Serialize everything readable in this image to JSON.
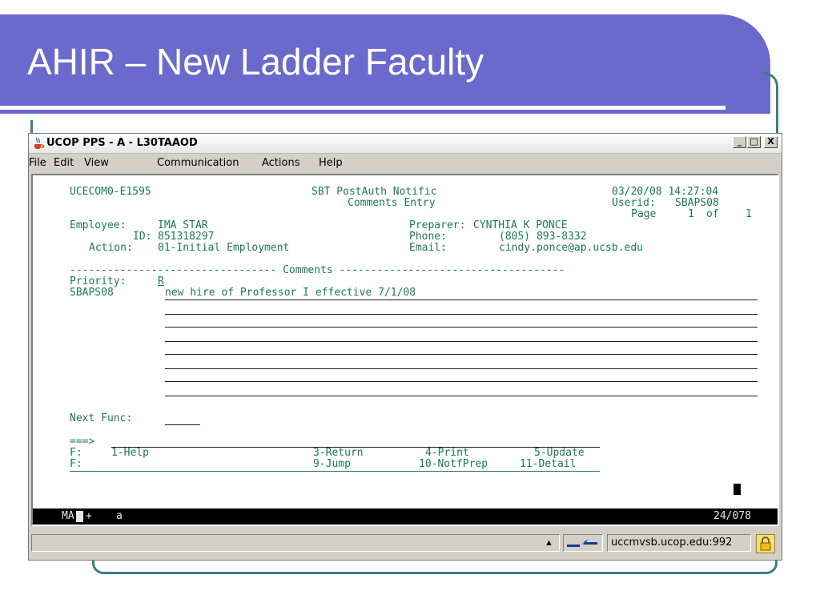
{
  "slide": {
    "title": "AHIR – New Ladder Faculty"
  },
  "window": {
    "title": "UCOP PPS - A - L30TAAOD",
    "controls": {
      "minimize": "_",
      "maximize": "□",
      "close": "X"
    },
    "menu": [
      "File",
      "Edit",
      "View",
      "Communication",
      "Actions",
      "Help"
    ]
  },
  "terminal": {
    "screen_id": "UCECOM0-E1595",
    "header1": "SBT PostAuth Notific",
    "header2": "Comments Entry",
    "datetime": "03/20/08 14:27:04",
    "userid_label": "Userid:",
    "userid": "SBAPS08",
    "page_label": "Page",
    "page_num": "1",
    "page_of": "of",
    "page_total": "1",
    "employee_label": "Employee:",
    "employee": "IMA STAR",
    "id_label": "ID:",
    "id": "851318297",
    "action_label": "Action:",
    "action": "01-Initial Employment",
    "preparer_label": "Preparer:",
    "preparer": "CYNTHIA K PONCE",
    "phone_label": "Phone:",
    "phone": "(805) 893-8332",
    "email_label": "Email:",
    "email": "cindy.ponce@ap.ucsb.edu",
    "comments_divider": "--------------------------------- Comments ------------------------------------",
    "priority_label": "Priority:",
    "priority": "R",
    "comment_user": "SBAPS08",
    "comment_text": "new hire of Professor I effective 7/1/08",
    "next_func_label": "Next Func:",
    "command_prompt": "===>",
    "fkeys_row1": {
      "label": "F:",
      "help": "1-Help",
      "ret": "3-Return",
      "print": "4-Print",
      "update": "5-Update"
    },
    "fkeys_row2": {
      "label": "F:",
      "jump": "9-Jump",
      "notfprep": "10-NotfPrep",
      "detail": "11-Detail"
    },
    "status_left": "MA",
    "status_mid": "a",
    "status_plus": "+",
    "cursor_pos": "24/078"
  },
  "statusbar": {
    "host": "uccmvsb.ucop.edu:992"
  },
  "colors": {
    "title_bg": "#6a6acc",
    "accent_teal": "#3a8080",
    "terminal_text": "#1a7a50"
  }
}
